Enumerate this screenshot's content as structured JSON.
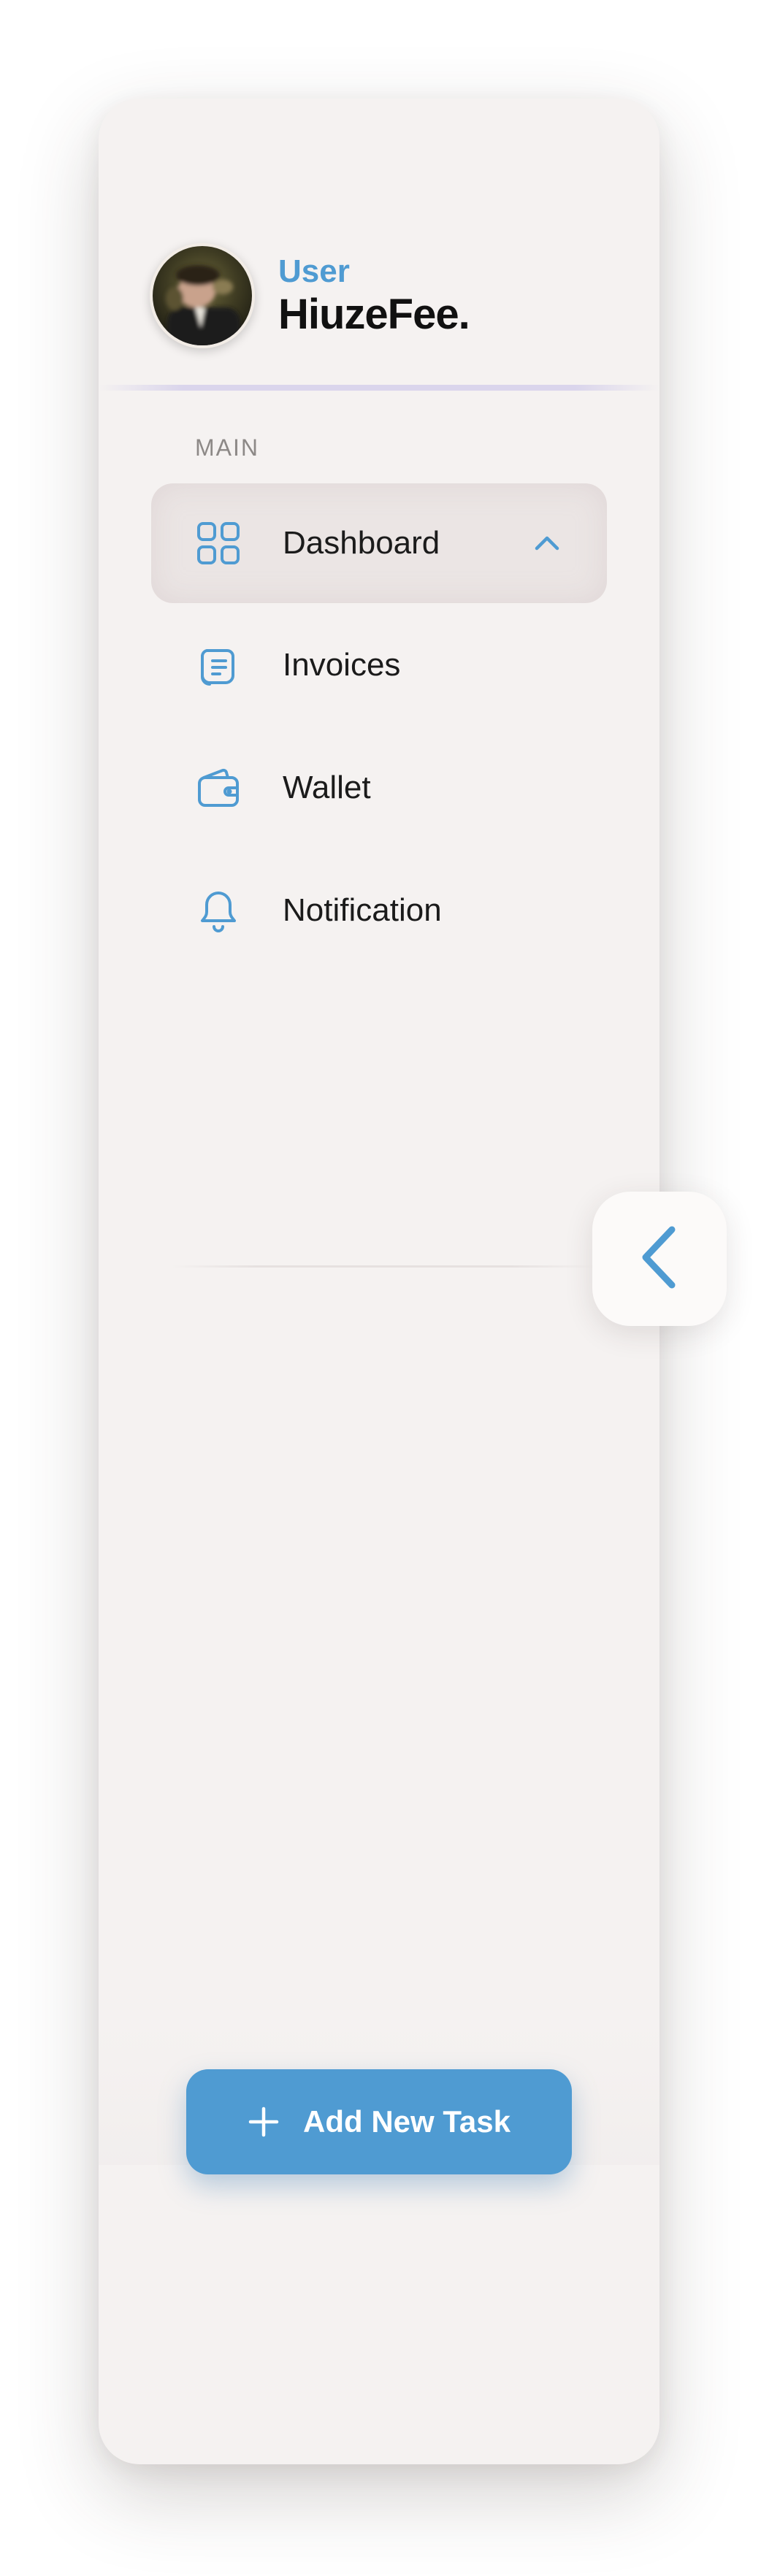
{
  "profile": {
    "role": "User",
    "username": "HiuzeFee."
  },
  "nav": {
    "section_label": "MAIN",
    "items": [
      {
        "label": "Dashboard",
        "icon": "grid-icon",
        "active": true
      },
      {
        "label": "Invoices",
        "icon": "document-icon",
        "active": false
      },
      {
        "label": "Wallet",
        "icon": "wallet-icon",
        "active": false
      },
      {
        "label": "Notification",
        "icon": "bell-icon",
        "active": false
      }
    ]
  },
  "actions": {
    "add_task_label": "Add New Task"
  },
  "colors": {
    "accent": "#4f9bd2",
    "sidebar_bg": "#f5f2f1",
    "text_primary": "#1b1b1b",
    "section_label": "#8d8987"
  }
}
